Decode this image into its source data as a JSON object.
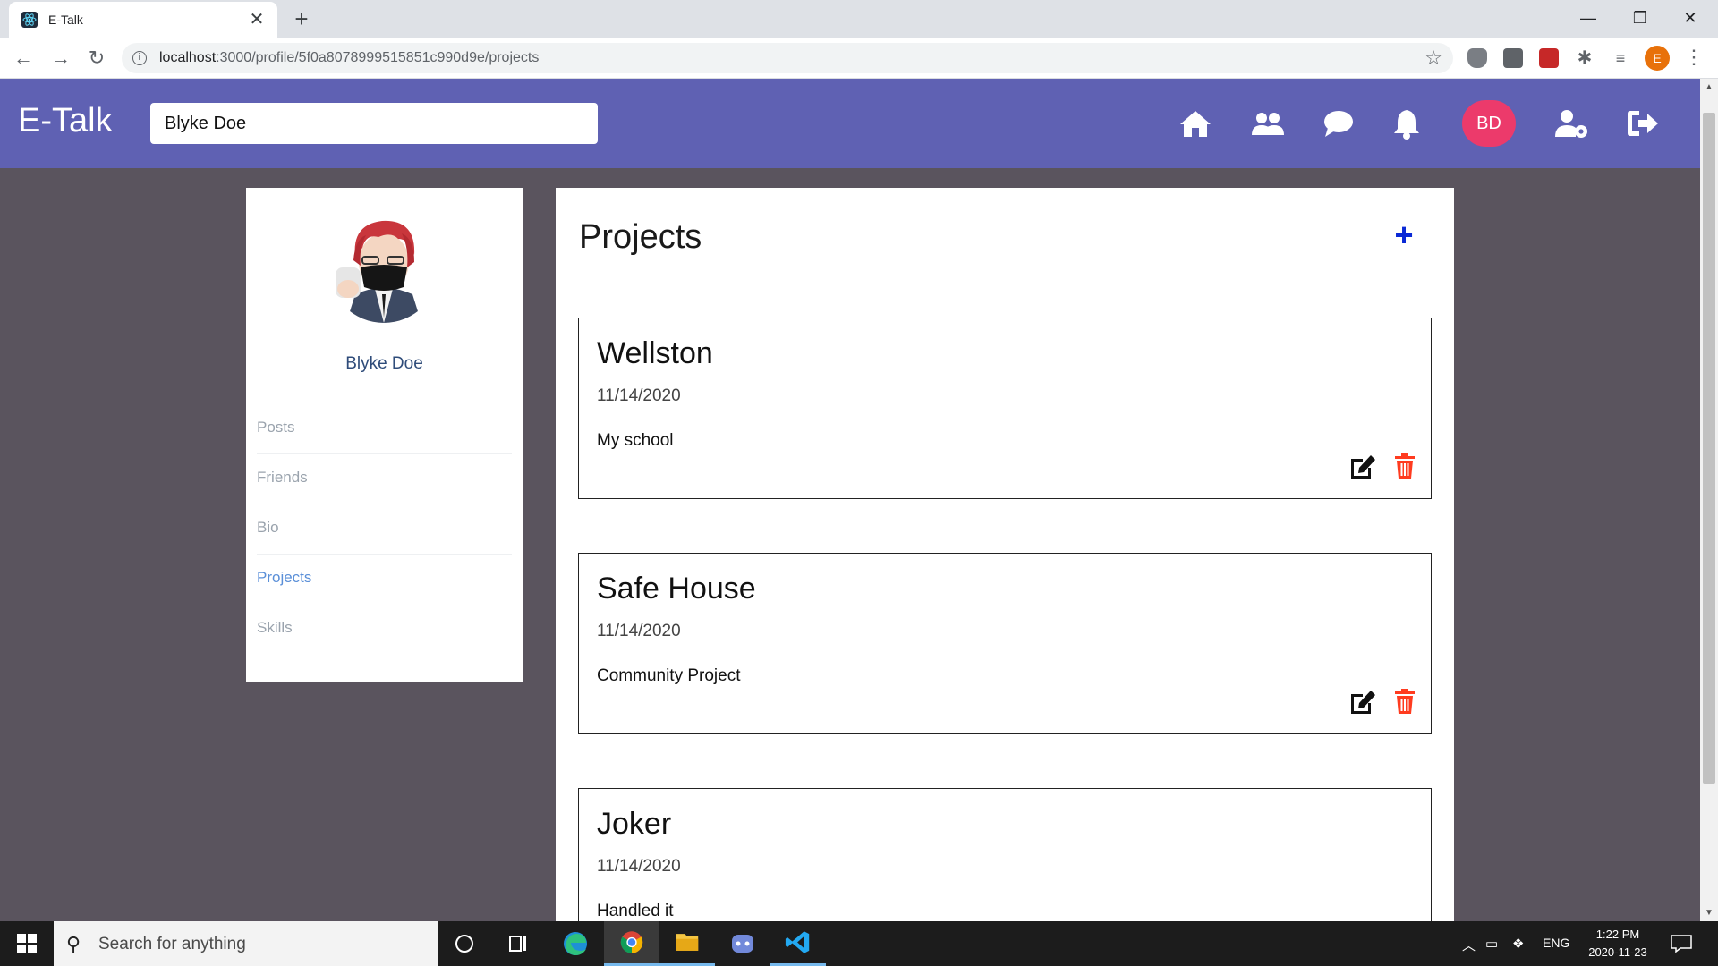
{
  "browser": {
    "tab_title": "E-Talk",
    "url_host": "localhost",
    "url_rest": ":3000/profile/5f0a8078999515851c990d9e/projects"
  },
  "app": {
    "brand": "E-Talk",
    "search_value": "Blyke Doe",
    "user_initials": "BD",
    "accent_color": "#5f61b3",
    "badge_color": "#ec3a6b"
  },
  "sidebar": {
    "name": "Blyke Doe",
    "items": [
      {
        "label": "Posts"
      },
      {
        "label": "Friends"
      },
      {
        "label": "Bio"
      },
      {
        "label": "Projects"
      },
      {
        "label": "Skills"
      }
    ]
  },
  "main": {
    "title": "Projects",
    "add_label": "+",
    "projects": [
      {
        "title": "Wellston",
        "date": "11/14/2020",
        "description": "My school"
      },
      {
        "title": "Safe House",
        "date": "11/14/2020",
        "description": "Community Project"
      },
      {
        "title": "Joker",
        "date": "11/14/2020",
        "description": "Handled it"
      }
    ]
  },
  "taskbar": {
    "search_placeholder": "Search for anything",
    "lang": "ENG",
    "time": "1:22 PM",
    "date": "2020-11-23"
  }
}
